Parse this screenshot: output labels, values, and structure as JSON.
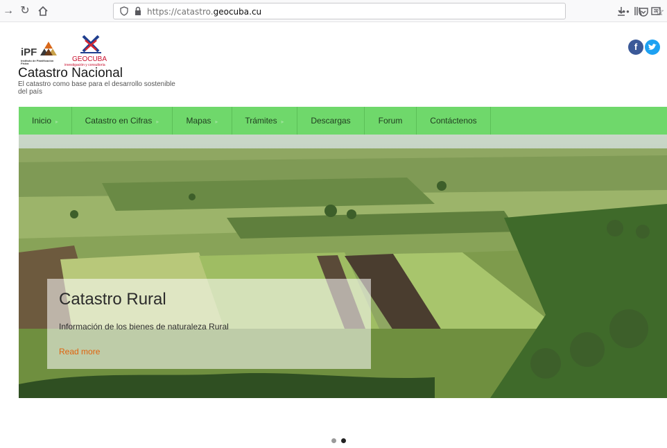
{
  "browser": {
    "url_prefix": "https://catastro.",
    "url_domain": "geocuba.cu",
    "more_label": "•••"
  },
  "header": {
    "ipf_logo_text": "iPF",
    "ipf_subtitle": "Instituto de Planificación Física",
    "geocuba_name": "GEOCUBA",
    "geocuba_subtitle": "investigación y consultoría",
    "site_title": "Catastro Nacional",
    "site_tagline": "El catastro como base para el desarrollo sostenible del país"
  },
  "social": {
    "facebook_label": "f",
    "twitter_label": "t"
  },
  "nav": {
    "items": [
      {
        "label": "Inicio",
        "has_caret": true
      },
      {
        "label": "Catastro en Cifras",
        "has_caret": true
      },
      {
        "label": "Mapas",
        "has_caret": true
      },
      {
        "label": "Trámites",
        "has_caret": true
      },
      {
        "label": "Descargas",
        "has_caret": false
      },
      {
        "label": "Forum",
        "has_caret": false
      },
      {
        "label": "Contáctenos",
        "has_caret": false
      }
    ],
    "caret": "▸"
  },
  "hero": {
    "title": "Catastro Rural",
    "text": "Información de los bienes de naturaleza Rural",
    "link_label": "Read more"
  },
  "carousel": {
    "dots": [
      {
        "active": false
      },
      {
        "active": true
      }
    ]
  },
  "colors": {
    "nav_bg": "#6fd86b",
    "link": "#e0620c",
    "facebook": "#3b5998",
    "twitter": "#1da1f2"
  }
}
